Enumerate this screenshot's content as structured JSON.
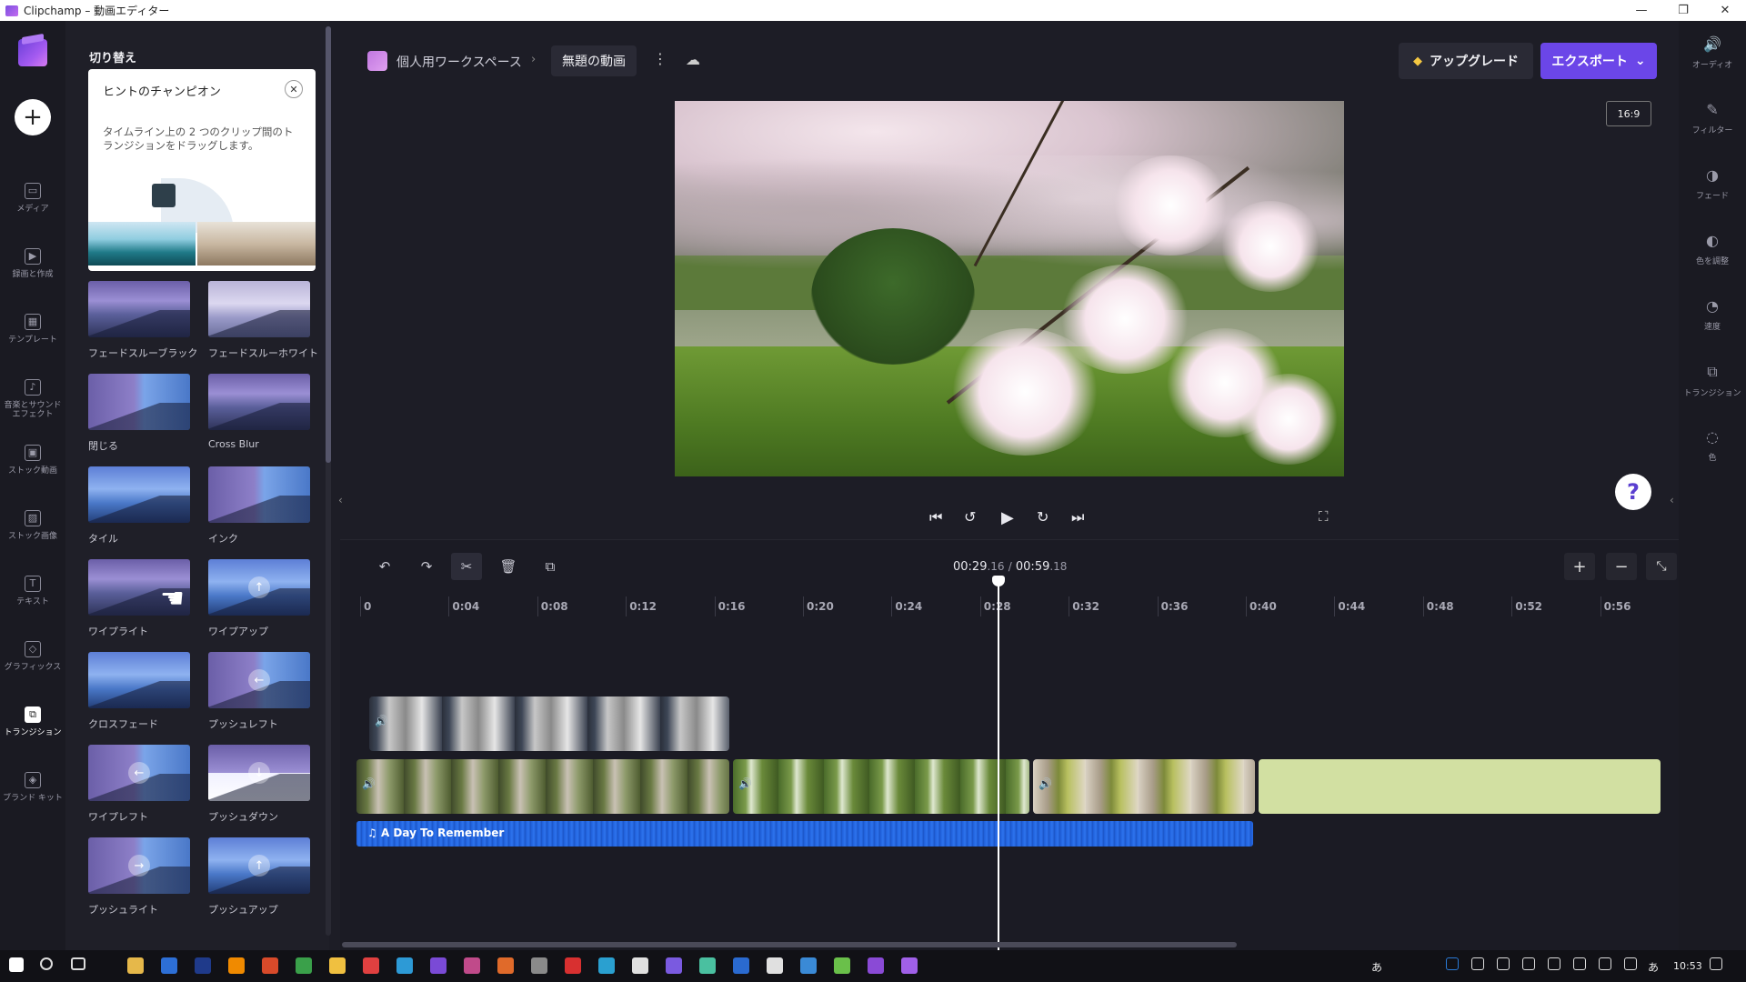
{
  "window": {
    "title": "Clipchamp – 動画エディター",
    "minimize": "—",
    "restore": "❐",
    "close": "✕"
  },
  "leftnav": {
    "add_label": "+",
    "items": [
      {
        "label": "メディア",
        "icon": "folder-icon",
        "glyph": "▭"
      },
      {
        "label": "録画と作成",
        "icon": "camera-icon",
        "glyph": "▶"
      },
      {
        "label": "テンプレート",
        "icon": "template-icon",
        "glyph": "▦"
      },
      {
        "label": "音楽とサウンド エフェクト",
        "icon": "music-icon",
        "glyph": "♪"
      },
      {
        "label": "ストック動画",
        "icon": "film-icon",
        "glyph": "▣"
      },
      {
        "label": "ストック画像",
        "icon": "image-icon",
        "glyph": "▨"
      },
      {
        "label": "テキスト",
        "icon": "text-icon",
        "glyph": "T"
      },
      {
        "label": "グラフィックス",
        "icon": "shapes-icon",
        "glyph": "◇"
      },
      {
        "label": "トランジション",
        "icon": "transition-icon",
        "glyph": "⧉"
      },
      {
        "label": "ブランド キット",
        "icon": "brand-icon",
        "glyph": "◈"
      }
    ],
    "active": 8
  },
  "panel": {
    "title": "切り替え",
    "tip": {
      "heading": "ヒントのチャンピオン",
      "close": "✕",
      "body": "タイムライン上の 2 つのクリップ間のトランジションをドラッグします。"
    },
    "transitions": [
      {
        "label": "フェードスルーブラック",
        "style": "mt-purple",
        "glyph": ""
      },
      {
        "label": "フェードスルーホワイト",
        "style": "mt-light",
        "glyph": ""
      },
      {
        "label": "閉じる",
        "style": "mt-mix",
        "glyph": ""
      },
      {
        "label": "Cross Blur",
        "style": "mt-purple",
        "glyph": ""
      },
      {
        "label": "タイル",
        "style": "mt-blue",
        "glyph": ""
      },
      {
        "label": "インク",
        "style": "mt-mix",
        "glyph": ""
      },
      {
        "label": "ワイプライト",
        "style": "mt-purple",
        "glyph": ""
      },
      {
        "label": "ワイプアップ",
        "style": "mt-blue",
        "glyph": "↑"
      },
      {
        "label": "クロスフェード",
        "style": "mt-blue",
        "glyph": ""
      },
      {
        "label": "プッシュレフト",
        "style": "mt-mix",
        "glyph": "←"
      },
      {
        "label": "ワイプレフト",
        "style": "mt-mix",
        "glyph": "←"
      },
      {
        "label": "プッシュダウン",
        "style": "mt-split",
        "glyph": "↓"
      },
      {
        "label": "プッシュライト",
        "style": "mt-mix",
        "glyph": "→"
      },
      {
        "label": "プッシュアップ",
        "style": "mt-blue",
        "glyph": "↑"
      }
    ]
  },
  "header": {
    "workspace": "個人用ワークスペース",
    "separator": "›",
    "project_name": "無題の動画",
    "more": "⋮",
    "cloud_glyph": "☁",
    "upgrade_label": "アップグレード",
    "upgrade_glyph": "◆",
    "export_label": "エクスポート",
    "export_chevron": "⌄"
  },
  "preview": {
    "aspect_ratio": "16:9",
    "help": "?"
  },
  "player": {
    "skip_back": "⏮",
    "rewind": "↺",
    "play": "▶",
    "forward": "↻",
    "skip_forward": "⏭",
    "fullscreen": "⛶"
  },
  "timeline": {
    "tools": {
      "undo": "↶",
      "redo": "↷",
      "cut": "✂",
      "delete": "🗑",
      "duplicate": "⧉"
    },
    "current_time": "00:29",
    "current_frac": ".16",
    "divider": "/",
    "total_time": "00:59",
    "total_frac": ".18",
    "zoom_in": "+",
    "zoom_out": "−",
    "fit": "⤡",
    "ruler": [
      "0",
      "0:04",
      "0:08",
      "0:12",
      "0:16",
      "0:20",
      "0:24",
      "0:28",
      "0:32",
      "0:36",
      "0:40",
      "0:44",
      "0:48",
      "0:52",
      "0:56"
    ],
    "audio_clip_title": "A Day To Remember",
    "audio_glyph": "♫",
    "volume_glyph": "🔊"
  },
  "rightbar": {
    "items": [
      {
        "label": "オーディオ",
        "icon": "speaker-icon",
        "glyph": "🔊"
      },
      {
        "label": "フィルター",
        "icon": "wand-icon",
        "glyph": "✎"
      },
      {
        "label": "フェード",
        "icon": "fade-icon",
        "glyph": "◑"
      },
      {
        "label": "色を調整",
        "icon": "color-adjust-icon",
        "glyph": "◐"
      },
      {
        "label": "速度",
        "icon": "speed-icon",
        "glyph": "◔"
      },
      {
        "label": "トランジション",
        "icon": "transition-icon",
        "glyph": "⧉"
      },
      {
        "label": "色",
        "icon": "palette-icon",
        "glyph": "◌"
      }
    ]
  },
  "taskbar": {
    "time": "10:53",
    "ime1": "あ",
    "ime2": "あ"
  },
  "colors": {
    "accent": "#6b46e8",
    "audio": "#1f5ed8",
    "background": "#1d1d26"
  }
}
